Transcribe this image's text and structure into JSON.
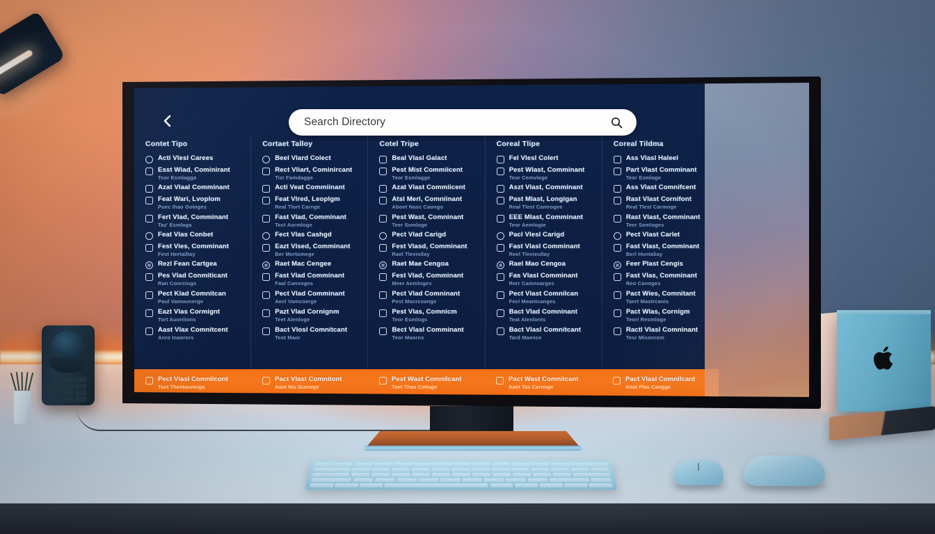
{
  "scene": {
    "wall_gradient_from": "#f08a5a",
    "wall_gradient_to": "#53708f",
    "desk_color": "#c4d8e6",
    "led_strip_color": "#fff4e2",
    "accent_orange": "#f47218",
    "panel_navy": "#0d2145"
  },
  "app": {
    "back_button_label": "Back",
    "search": {
      "placeholder": "Search Directory",
      "value": "",
      "icon": "search-icon"
    },
    "columns": [
      {
        "header": "Contet Tipo",
        "items": [
          {
            "ctrl": "circle",
            "main": "Acti Vlesl Carees",
            "sub": ""
          },
          {
            "ctrl": "box",
            "main": "Esst Wiad, Cominirant",
            "sub": "Teor Esmlagga"
          },
          {
            "ctrl": "box",
            "main": "Azat Vlaal Comminant",
            "sub": ""
          },
          {
            "ctrl": "box",
            "main": "Feat Wari, Lvoplom",
            "sub": "Puec Ihao Goinges"
          },
          {
            "ctrl": "box",
            "main": "Fert Vlad, Comminant",
            "sub": "Taz' Esmlaga"
          },
          {
            "ctrl": "circle",
            "main": "Feat Vlas Conbet",
            "sub": ""
          },
          {
            "ctrl": "box",
            "main": "Fest Vies, Comminant",
            "sub": "Fest Hertailtay"
          },
          {
            "ctrl": "dot",
            "main": "Rezl Fean Cartgea",
            "sub": ""
          },
          {
            "ctrl": "box",
            "main": "Pes Vlad Conmiticant",
            "sub": "Ran Conrcings"
          },
          {
            "ctrl": "box",
            "main": "Pect Klad Comnitcan",
            "sub": "Paul Vamounerge"
          },
          {
            "ctrl": "box",
            "main": "Eazt Vlas Cormignt",
            "sub": "Tort Auonlions"
          },
          {
            "ctrl": "box",
            "main": "Aast Vlax Comnitcent",
            "sub": "Anro Inaorors"
          }
        ],
        "highlight": {
          "ctrl": "box",
          "main": "Pect Vlasl Comnilcont",
          "sub": "Toet Thentoumngs"
        }
      },
      {
        "header": "Cortaet Talloy",
        "items": [
          {
            "ctrl": "circle",
            "main": "Beel Vlard Colect",
            "sub": ""
          },
          {
            "ctrl": "box",
            "main": "Rect Vliart, Cominircant",
            "sub": "Tizr Famdagge"
          },
          {
            "ctrl": "box",
            "main": "Acti Veat Commiinant",
            "sub": ""
          },
          {
            "ctrl": "box",
            "main": "Feat Vlred, Leoplgm",
            "sub": "Real Tlort Carnge"
          },
          {
            "ctrl": "box",
            "main": "Fast Vlad, Comminant",
            "sub": "Tect Aormloge"
          },
          {
            "ctrl": "circle",
            "main": "Fect Vlas Cashgd",
            "sub": ""
          },
          {
            "ctrl": "box",
            "main": "Eazt Vlsed, Comminant",
            "sub": "Ber Mertomege"
          },
          {
            "ctrl": "dot",
            "main": "Raet Mac Cengee",
            "sub": ""
          },
          {
            "ctrl": "box",
            "main": "Fast Vlad Comminant",
            "sub": "Faal Canvoges"
          },
          {
            "ctrl": "box",
            "main": "Pect Vlad Comminant",
            "sub": "Aecl Vamcoerge"
          },
          {
            "ctrl": "box",
            "main": "Pazt Vlad Cornignm",
            "sub": "Teet Alenloge"
          },
          {
            "ctrl": "box",
            "main": "Bact Vlosl Comnitcant",
            "sub": "Teot Maor"
          }
        ],
        "highlight": {
          "ctrl": "box",
          "main": "Pact Vlast Comnitont",
          "sub": "Aaot Nis Gumege"
        }
      },
      {
        "header": "Cotel Tripe",
        "items": [
          {
            "ctrl": "box",
            "main": "Beal Vlasl Galact",
            "sub": ""
          },
          {
            "ctrl": "box",
            "main": "Pest Mist Commiicent",
            "sub": "Teor Esmlagge"
          },
          {
            "ctrl": "box",
            "main": "Azat Vlast Commiicent",
            "sub": ""
          },
          {
            "ctrl": "box",
            "main": "Atsl Merl, Comniinant",
            "sub": "Aboet Nasc Caongo"
          },
          {
            "ctrl": "box",
            "main": "Pest Wast, Comninant",
            "sub": "Teer Somloge"
          },
          {
            "ctrl": "circle",
            "main": "Pect Vlad Carigd",
            "sub": ""
          },
          {
            "ctrl": "box",
            "main": "Fest Vlasd, Comminant",
            "sub": "Rael Tleviollay"
          },
          {
            "ctrl": "dot",
            "main": "Raet Mae Cengoa",
            "sub": ""
          },
          {
            "ctrl": "box",
            "main": "Fest Vlad, Comminant",
            "sub": "Meer Aemloges"
          },
          {
            "ctrl": "box",
            "main": "Pect Vlad Comninant",
            "sub": "Pest Macrcoange"
          },
          {
            "ctrl": "box",
            "main": "Pest Vlas, Comnicm",
            "sub": "Teor Esmlogs"
          },
          {
            "ctrl": "box",
            "main": "Bect Vlasl Comminant",
            "sub": "Teor Maorns"
          }
        ],
        "highlight": {
          "ctrl": "box",
          "main": "Pest Wast Comnilcant",
          "sub": "Toet Thas Cotiage"
        }
      },
      {
        "header": "Coreal Tlipe",
        "items": [
          {
            "ctrl": "box",
            "main": "Fel Vlesl Colert",
            "sub": ""
          },
          {
            "ctrl": "box",
            "main": "Pest Wlast, Comminant",
            "sub": "Teor Cemvloge"
          },
          {
            "ctrl": "box",
            "main": "Aszt Vlast, Comminant",
            "sub": ""
          },
          {
            "ctrl": "box",
            "main": "Past Mlast, Longigan",
            "sub": "Real Tlest Camrogee"
          },
          {
            "ctrl": "box",
            "main": "EEE Mlast, Comminant",
            "sub": "Teor Aemlogie"
          },
          {
            "ctrl": "circle",
            "main": "Pacl Vlesl Carigd",
            "sub": ""
          },
          {
            "ctrl": "box",
            "main": "Fast Vlasl Comminant",
            "sub": "Reel Tlevieullay"
          },
          {
            "ctrl": "dot",
            "main": "Rael Mao Cengoa",
            "sub": ""
          },
          {
            "ctrl": "box",
            "main": "Fas Vlasl Comminant",
            "sub": "Rerr Camnoarges"
          },
          {
            "ctrl": "box",
            "main": "Pect Vlast Comnilcan",
            "sub": "Fecl Meantcanges"
          },
          {
            "ctrl": "box",
            "main": "Bact Vlad Comninant",
            "sub": "Teat Alenlonts"
          },
          {
            "ctrl": "box",
            "main": "Bact Vlasl Comnitcant",
            "sub": "Tard Maence"
          }
        ],
        "highlight": {
          "ctrl": "box",
          "main": "Pact Wast Comnilcant",
          "sub": "Aaot Tas Carnoge"
        }
      },
      {
        "header": "Coreal Tildma",
        "items": [
          {
            "ctrl": "box",
            "main": "Ass Vlasl Haleel",
            "sub": ""
          },
          {
            "ctrl": "box",
            "main": "Part Vlast Comminant",
            "sub": "Teor Esmlage"
          },
          {
            "ctrl": "box",
            "main": "Ass Vlast Comnifcent",
            "sub": ""
          },
          {
            "ctrl": "box",
            "main": "Rast Vlast Cornifont",
            "sub": "Real Tlest Carmoge"
          },
          {
            "ctrl": "box",
            "main": "Rast Vlast, Comminant",
            "sub": "Teer Semloges"
          },
          {
            "ctrl": "circle",
            "main": "Pect Vlast Carlet",
            "sub": ""
          },
          {
            "ctrl": "box",
            "main": "Fast Vlast, Comminant",
            "sub": "Berl Hontaliay"
          },
          {
            "ctrl": "dot",
            "main": "Feer Plast Cengis",
            "sub": ""
          },
          {
            "ctrl": "box",
            "main": "Fast Vlas, Comminant",
            "sub": "Reo Canoges"
          },
          {
            "ctrl": "box",
            "main": "Pact Wies, Comnitant",
            "sub": "Taert Mastrcanis"
          },
          {
            "ctrl": "box",
            "main": "Pact Wlas, Cornigm",
            "sub": "Teori Resmloge"
          },
          {
            "ctrl": "box",
            "main": "Ractl Vlasl Comninant",
            "sub": "Tesr Misonrom"
          }
        ],
        "highlight": {
          "ctrl": "box",
          "main": "Pact Vlasl Comnilcant",
          "sub": "Anot Plas Cangge"
        }
      }
    ]
  },
  "desk_objects": {
    "lamp": "desk-lamp",
    "phone": "desk-phone",
    "pencil_cup": "pencil-cup",
    "keyboard": "keyboard",
    "mouse_small": "mouse-small",
    "mouse_large": "mouse-large",
    "apple_box": "apple-product-box",
    "tablet": "tablet-device"
  }
}
